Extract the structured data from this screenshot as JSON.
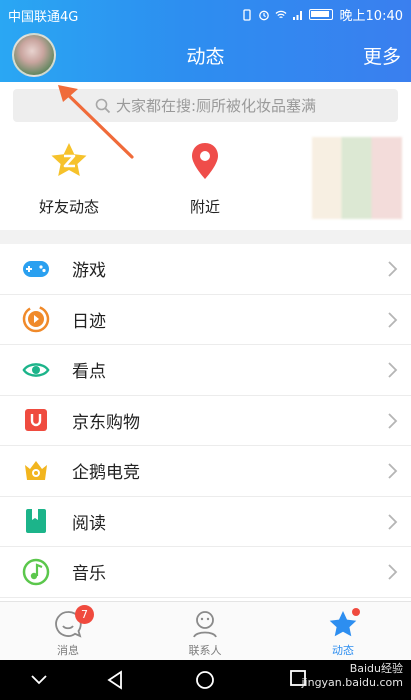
{
  "status": {
    "carrier": "中国联通4G",
    "time": "晚上10:40"
  },
  "header": {
    "title": "动态",
    "more": "更多"
  },
  "search": {
    "placeholder": "大家都在搜:厕所被化妆品塞满"
  },
  "quick": [
    {
      "label": "好友动态",
      "icon": "friends-feed-icon"
    },
    {
      "label": "附近",
      "icon": "location-pin-icon"
    }
  ],
  "list": [
    {
      "label": "游戏",
      "icon": "gamepad-icon",
      "color": "#2aa0f0"
    },
    {
      "label": "日迹",
      "icon": "daily-trace-icon",
      "color": "#f08a2a"
    },
    {
      "label": "看点",
      "icon": "eye-icon",
      "color": "#1cb48a"
    },
    {
      "label": "京东购物",
      "icon": "jd-shopping-icon",
      "color": "#ef4b3f"
    },
    {
      "label": "企鹅电竞",
      "icon": "esports-crown-icon",
      "color": "#f2b51e"
    },
    {
      "label": "阅读",
      "icon": "book-icon",
      "color": "#1cb48a"
    },
    {
      "label": "音乐",
      "icon": "music-note-icon",
      "color": "#5bc74c"
    }
  ],
  "tabs": [
    {
      "label": "消息",
      "badge": "7"
    },
    {
      "label": "联系人"
    },
    {
      "label": "动态"
    }
  ],
  "watermark": {
    "line1": "Baidu经验",
    "line2": "jingyan.baidu.com"
  },
  "colors": {
    "accent": "#2d8ef0",
    "badge": "#f04a3e"
  }
}
